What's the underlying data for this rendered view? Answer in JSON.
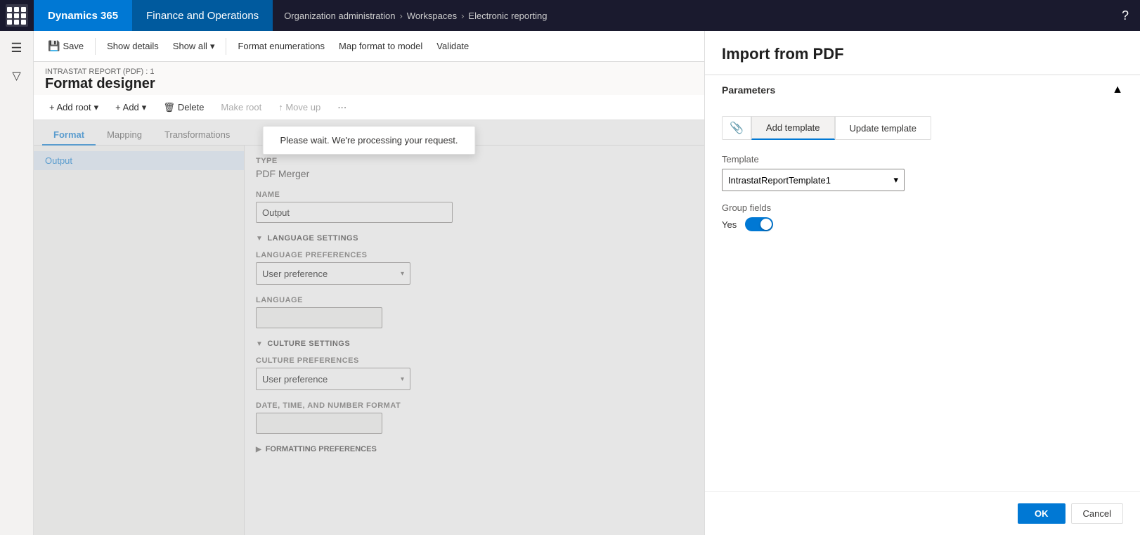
{
  "topNav": {
    "appIcon": "apps-icon",
    "d365Label": "Dynamics 365",
    "foLabel": "Finance and Operations",
    "breadcrumb": [
      "Organization administration",
      "Workspaces",
      "Electronic reporting"
    ],
    "breadcrumbSeparator": "›"
  },
  "toolbar": {
    "saveLabel": "Save",
    "showDetailsLabel": "Show details",
    "showAllLabel": "Show all",
    "formatEnumerationsLabel": "Format enumerations",
    "mapFormatToModelLabel": "Map format to model",
    "validateLabel": "Validate"
  },
  "pageHeader": {
    "breadcrumb": "INTRASTAT REPORT (PDF) : 1",
    "title": "Format designer"
  },
  "actionBar": {
    "addRootLabel": "+ Add root",
    "addLabel": "+ Add",
    "deleteLabel": "Delete",
    "makeRootLabel": "Make root",
    "moveUpLabel": "↑ Move up",
    "moreLabel": "···"
  },
  "tabs": {
    "format": "Format",
    "mapping": "Mapping",
    "transformations": "Transformations"
  },
  "tree": {
    "items": [
      {
        "label": "Output",
        "selected": true
      }
    ]
  },
  "properties": {
    "typeLabel": "Type",
    "typeValue": "PDF Merger",
    "nameLabel": "Name",
    "nameValue": "Output",
    "languageSettings": {
      "sectionLabel": "LANGUAGE SETTINGS",
      "languagePreferencesLabel": "Language preferences",
      "languagePreferencesValue": "User preference",
      "languageLabel": "Language"
    },
    "cultureSettings": {
      "sectionLabel": "CULTURE SETTINGS",
      "culturePreferencesLabel": "Culture preferences",
      "culturePreferencesValue": "User preference",
      "dateTimeLabel": "Date, time, and number format"
    },
    "formattingPreferences": {
      "sectionLabel": "FORMATTING PREFERENCES"
    }
  },
  "processingToast": {
    "message": "Please wait. We're processing your request."
  },
  "importPanel": {
    "title": "Import from PDF",
    "parametersLabel": "Parameters",
    "collapseIcon": "▲",
    "attachIconLabel": "📎",
    "addTemplateLabel": "Add template",
    "updateTemplateLabel": "Update template",
    "templateLabel": "Template",
    "templateValue": "IntrastatReportTemplate1",
    "templateOptions": [
      "IntrastatReportTemplate1"
    ],
    "groupFieldsLabel": "Group fields",
    "groupFieldsYes": "Yes"
  },
  "footer": {
    "okLabel": "OK",
    "cancelLabel": "Cancel"
  }
}
